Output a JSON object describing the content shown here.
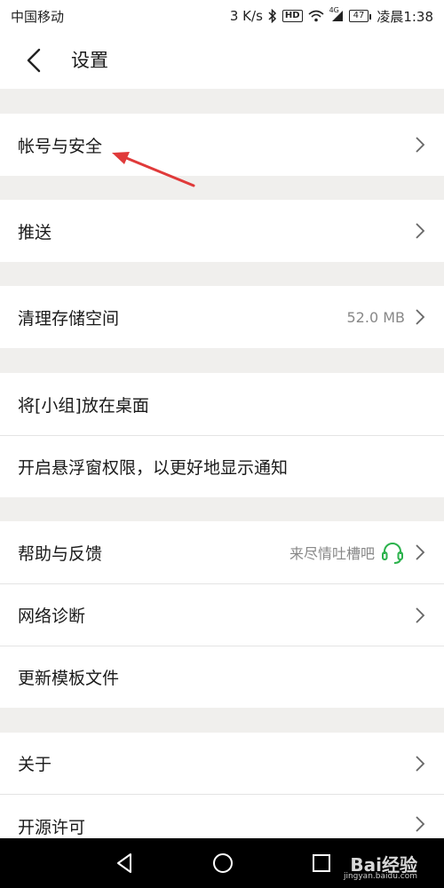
{
  "status": {
    "carrier": "中国移动",
    "speed": "3 K/s",
    "hd": "HD",
    "network": "4G",
    "battery": "47",
    "time": "凌晨1:38"
  },
  "header": {
    "title": "设置"
  },
  "rows": {
    "account": {
      "label": "帐号与安全"
    },
    "push": {
      "label": "推送"
    },
    "storage": {
      "label": "清理存储空间",
      "value": "52.0 MB"
    },
    "desktop": {
      "label": "将[小组]放在桌面"
    },
    "floating": {
      "label": "开启悬浮窗权限，以更好地显示通知"
    },
    "help": {
      "label": "帮助与反馈",
      "value": "来尽情吐槽吧"
    },
    "network": {
      "label": "网络诊断"
    },
    "templates": {
      "label": "更新模板文件"
    },
    "about": {
      "label": "关于"
    },
    "license": {
      "label": "开源许可"
    }
  },
  "watermark": {
    "text": "Bai经验",
    "sub": "jingyan.baidu.com"
  },
  "colors": {
    "accent_green": "#2bb24c",
    "arrow_red": "#e03a3a",
    "section_bg": "#f0efed"
  }
}
